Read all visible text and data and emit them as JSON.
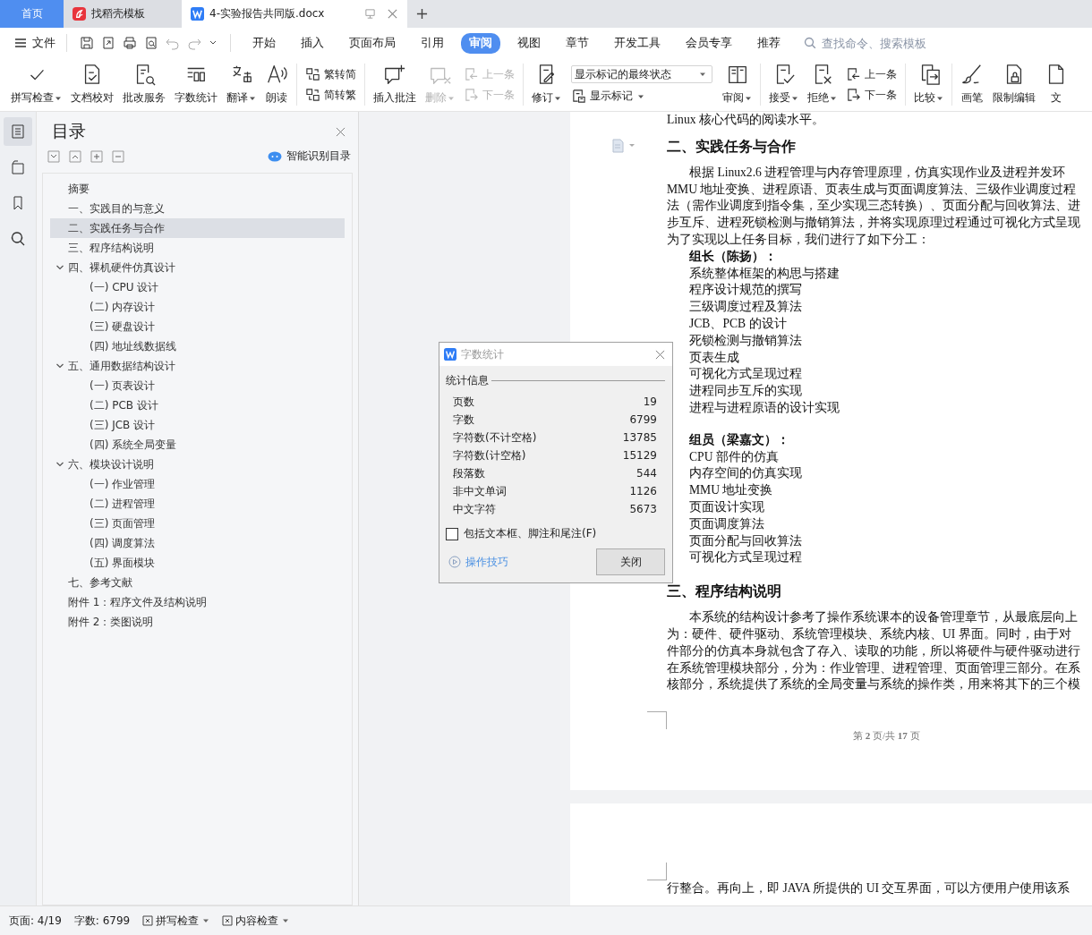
{
  "tabs": [
    {
      "label": "首页",
      "kind": "home",
      "selected": false
    },
    {
      "label": "找稻壳模板",
      "kind": "template",
      "selected": false
    },
    {
      "label": "4-实验报告共同版.docx",
      "kind": "document",
      "selected": true
    }
  ],
  "menu": {
    "file": "文件",
    "tabs": [
      {
        "label": "开始",
        "selected": false
      },
      {
        "label": "插入",
        "selected": false
      },
      {
        "label": "页面布局",
        "selected": false
      },
      {
        "label": "引用",
        "selected": false
      },
      {
        "label": "审阅",
        "selected": true
      },
      {
        "label": "视图",
        "selected": false
      },
      {
        "label": "章节",
        "selected": false
      },
      {
        "label": "开发工具",
        "selected": false
      },
      {
        "label": "会员专享",
        "selected": false
      },
      {
        "label": "推荐",
        "selected": false
      }
    ],
    "search": {
      "placeholder": "查找命令、搜索模板"
    }
  },
  "ribbon": [
    {
      "kind": "large",
      "label": "拼写检查",
      "caret": true,
      "disabled": false
    },
    {
      "kind": "large",
      "label": "文档校对",
      "caret": false,
      "disabled": false
    },
    {
      "kind": "large",
      "label": "批改服务",
      "caret": false,
      "disabled": false
    },
    {
      "kind": "large",
      "label": "字数统计",
      "caret": false,
      "disabled": false
    },
    {
      "kind": "large",
      "label": "翻译",
      "caret": true,
      "disabled": false
    },
    {
      "kind": "large",
      "label": "朗读",
      "caret": false,
      "disabled": false
    },
    {
      "kind": "pair",
      "items": [
        {
          "label": "繁转简",
          "disabled": false
        },
        {
          "label": "简转繁",
          "disabled": false
        }
      ]
    },
    {
      "kind": "large",
      "label": "插入批注",
      "caret": false,
      "disabled": false
    },
    {
      "kind": "large",
      "label": "删除",
      "caret": true,
      "disabled": true
    },
    {
      "kind": "pair",
      "items": [
        {
          "label": "上一条",
          "disabled": true
        },
        {
          "label": "下一条",
          "disabled": true
        }
      ]
    },
    {
      "kind": "large",
      "label": "修订",
      "caret": true,
      "disabled": false
    },
    {
      "kind": "combo",
      "value": "显示标记的最终状态",
      "sub": "显示标记"
    },
    {
      "kind": "large",
      "label": "审阅",
      "caret": true,
      "disabled": false
    },
    {
      "kind": "large",
      "label": "接受",
      "caret": true,
      "disabled": false
    },
    {
      "kind": "large",
      "label": "拒绝",
      "caret": true,
      "disabled": false
    },
    {
      "kind": "pair",
      "items": [
        {
          "label": "上一条",
          "disabled": false
        },
        {
          "label": "下一条",
          "disabled": false
        }
      ]
    },
    {
      "kind": "large",
      "label": "比较",
      "caret": true,
      "disabled": false
    },
    {
      "kind": "large",
      "label": "画笔",
      "caret": false,
      "disabled": false
    },
    {
      "kind": "large",
      "label": "限制编辑",
      "caret": false,
      "disabled": false
    },
    {
      "kind": "large",
      "label": "文",
      "caret": false,
      "disabled": false
    }
  ],
  "nav": {
    "title": "目录",
    "smart_button": "智能识别目录",
    "toc": [
      {
        "label": "摘要",
        "selected": false
      },
      {
        "label": "一、实践目的与意义",
        "selected": false
      },
      {
        "label": "二、实践任务与合作",
        "selected": true
      },
      {
        "label": "三、程序结构说明",
        "selected": false
      },
      {
        "label": "四、裸机硬件仿真设计",
        "selected": false,
        "expanded": true,
        "children": [
          {
            "label": "(一) CPU 设计",
            "selected": false
          },
          {
            "label": "(二) 内存设计",
            "selected": false
          },
          {
            "label": "(三) 硬盘设计",
            "selected": false
          },
          {
            "label": "(四) 地址线数据线",
            "selected": false
          }
        ]
      },
      {
        "label": "五、通用数据结构设计",
        "selected": false,
        "expanded": true,
        "children": [
          {
            "label": "(一) 页表设计",
            "selected": false
          },
          {
            "label": "(二) PCB 设计",
            "selected": false
          },
          {
            "label": "(三) JCB 设计",
            "selected": false
          },
          {
            "label": "(四) 系统全局变量",
            "selected": false
          }
        ]
      },
      {
        "label": "六、模块设计说明",
        "selected": false,
        "expanded": true,
        "children": [
          {
            "label": "(一) 作业管理",
            "selected": false
          },
          {
            "label": "(二) 进程管理",
            "selected": false
          },
          {
            "label": "(三) 页面管理",
            "selected": false
          },
          {
            "label": "(四) 调度算法",
            "selected": false
          },
          {
            "label": "(五) 界面模块",
            "selected": false
          }
        ]
      },
      {
        "label": "七、参考文献",
        "selected": false
      },
      {
        "label": "附件 1：程序文件及结构说明",
        "selected": false
      },
      {
        "label": "附件 2：类图说明",
        "selected": false
      }
    ]
  },
  "document": {
    "page_1": [
      {
        "kind": "line",
        "text": "Linux 核心代码的阅读水平。",
        "space_before": false
      },
      {
        "kind": "heading",
        "text": "二、实践任务与合作",
        "space_before": false
      },
      {
        "kind": "first_line",
        "text": "根据 Linux2.6 进程管理与内存管理原理，仿真实现作业及进程并发环",
        "space_before": false
      },
      {
        "kind": "line",
        "text": "MMU 地址变换、进程原语、页表生成与页面调度算法、三级作业调度过程",
        "space_before": false
      },
      {
        "kind": "line",
        "text": "法（需作业调度到指令集，至少实现三态转换）、页面分配与回收算法、进",
        "space_before": false
      },
      {
        "kind": "line",
        "text": "步互斥、进程死锁检测与撤销算法，并将实现原理过程通过可视化方式呈现",
        "space_before": false
      },
      {
        "kind": "line",
        "text": "为了实现以上任务目标，我们进行了如下分工：",
        "space_before": false
      },
      {
        "kind": "label",
        "text": "组长（陈扬）：",
        "space_before": false
      },
      {
        "kind": "item",
        "text": "系统整体框架的构思与搭建",
        "space_before": false
      },
      {
        "kind": "item",
        "text": "程序设计规范的撰写",
        "space_before": false
      },
      {
        "kind": "item",
        "text": "三级调度过程及算法",
        "space_before": false
      },
      {
        "kind": "item",
        "text": "JCB、PCB 的设计",
        "space_before": false
      },
      {
        "kind": "item",
        "text": "死锁检测与撤销算法",
        "space_before": false
      },
      {
        "kind": "item",
        "text": "页表生成",
        "space_before": false
      },
      {
        "kind": "item",
        "text": "可视化方式呈现过程",
        "space_before": false
      },
      {
        "kind": "item",
        "text": "进程同步互斥的实现",
        "space_before": false
      },
      {
        "kind": "item",
        "text": "进程与进程原语的设计实现",
        "space_before": false
      },
      {
        "kind": "label",
        "text": "组员（梁嘉文）：",
        "space_before": true
      },
      {
        "kind": "item",
        "text": "CPU 部件的仿真",
        "space_before": false
      },
      {
        "kind": "item",
        "text": "内存空间的仿真实现",
        "space_before": false
      },
      {
        "kind": "item",
        "text": "MMU 地址变换",
        "space_before": false
      },
      {
        "kind": "item",
        "text": "页面设计实现",
        "space_before": false
      },
      {
        "kind": "item",
        "text": "页面调度算法",
        "space_before": false
      },
      {
        "kind": "item",
        "text": "页面分配与回收算法",
        "space_before": false
      },
      {
        "kind": "item",
        "text": "可视化方式呈现过程",
        "space_before": false
      },
      {
        "kind": "heading",
        "text": "三、程序结构说明",
        "space_before": true
      },
      {
        "kind": "first_line",
        "text": "本系统的结构设计参考了操作系统课本的设备管理章节，从最底层向上",
        "space_before": false
      },
      {
        "kind": "line",
        "text": "为：硬件、硬件驱动、系统管理模块、系统内核、UI 界面。同时，由于对",
        "space_before": false
      },
      {
        "kind": "line",
        "text": "件部分的仿真本身就包含了存入、读取的功能，所以将硬件与硬件驱动进行",
        "space_before": false
      },
      {
        "kind": "line",
        "text": "在系统管理模块部分，分为：作业管理、进程管理、页面管理三部分。在系",
        "space_before": false
      },
      {
        "kind": "line",
        "text": "核部分，系统提供了系统的全局变量与系统的操作类，用来将其下的三个模",
        "space_before": false
      }
    ],
    "footer": "第 **2** 页/共 **17** 页",
    "page_2": [
      {
        "kind": "line",
        "text": "行整合。再向上，即 JAVA 所提供的 UI 交互界面，可以方便用户使用该系",
        "space_before": false
      }
    ]
  },
  "word_count_dialog": {
    "title": "字数统计",
    "section": "统计信息",
    "rows": [
      {
        "label": "页数",
        "value": "19"
      },
      {
        "label": "字数",
        "value": "6799"
      },
      {
        "label": "字符数(不计空格)",
        "value": "13785"
      },
      {
        "label": "字符数(计空格)",
        "value": "15129"
      },
      {
        "label": "段落数",
        "value": "544"
      },
      {
        "label": "非中文单词",
        "value": "1126"
      },
      {
        "label": "中文字符",
        "value": "5673"
      }
    ],
    "include_textboxes": {
      "label": "包括文本框、脚注和尾注(F)",
      "checked": false
    },
    "tips_link": "操作技巧",
    "close_button": "关闭"
  },
  "status_bar": [
    {
      "kind": "text",
      "label": "页面: 4/19"
    },
    {
      "kind": "text",
      "label": "字数: 6799"
    },
    {
      "kind": "menu",
      "label": "拼写检查"
    },
    {
      "kind": "menu",
      "label": "内容检查"
    }
  ]
}
